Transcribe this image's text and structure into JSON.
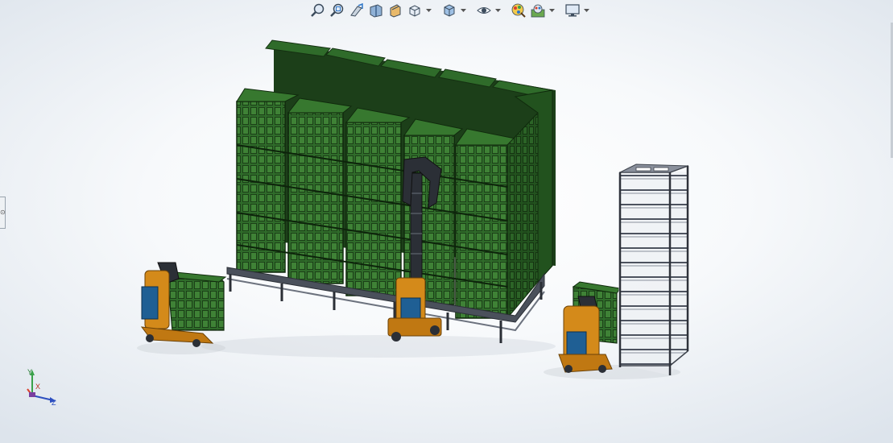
{
  "toolbar": {
    "items": [
      {
        "name": "zoom-to-fit-icon",
        "dropdown": false
      },
      {
        "name": "zoom-to-area-icon",
        "dropdown": false
      },
      {
        "name": "previous-view-icon",
        "dropdown": false
      },
      {
        "name": "section-view-icon",
        "dropdown": false
      },
      {
        "name": "dynamic-annotation-views-icon",
        "dropdown": false
      },
      {
        "name": "view-orientation-icon",
        "dropdown": true
      },
      {
        "name": "display-style-icon",
        "dropdown": true
      },
      {
        "name": "hide-show-items-icon",
        "dropdown": true
      },
      {
        "name": "edit-appearance-icon",
        "dropdown": false
      },
      {
        "name": "apply-scene-icon",
        "dropdown": true
      },
      {
        "name": "view-settings-icon",
        "dropdown": true
      }
    ]
  },
  "triad": {
    "y_label": "Y",
    "x_label": "X",
    "z_label": "Z"
  },
  "left_tab": {
    "label": "⊙"
  },
  "colors": {
    "crate_green": "#2f6b2a",
    "crate_dark": "#1c3f19",
    "robot_blue": "#1f5f94",
    "robot_orange": "#d48a1a",
    "rack_gray": "#5c6270"
  }
}
